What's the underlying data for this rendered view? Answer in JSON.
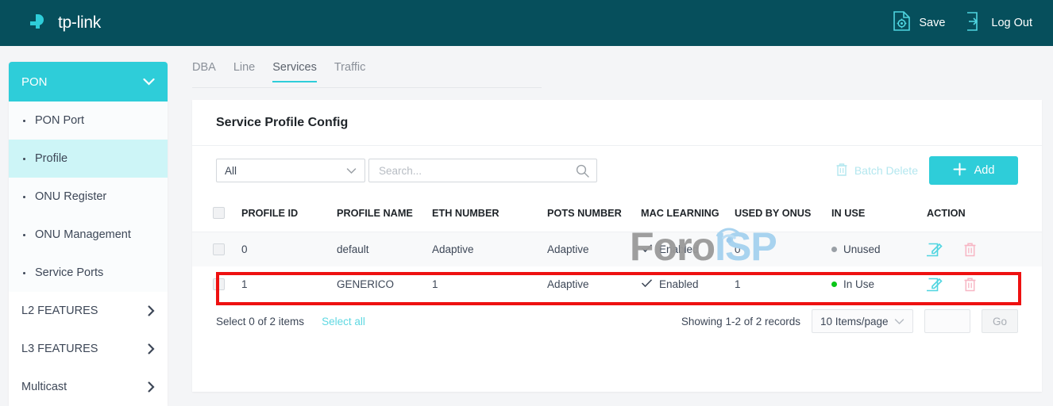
{
  "header": {
    "brand": "tp-link",
    "brand_icon": "tplink-logo-icon",
    "save_label": "Save",
    "save_icon": "save-document-gear-icon",
    "logout_label": "Log Out",
    "logout_icon": "logout-arrow-icon"
  },
  "sidebar": {
    "group_label": "PON",
    "group_icon": "chevron-down-icon",
    "items": [
      {
        "label": "PON Port",
        "active": false
      },
      {
        "label": "Profile",
        "active": true
      },
      {
        "label": "ONU Register",
        "active": false
      },
      {
        "label": "ONU Management",
        "active": false
      },
      {
        "label": "Service Ports",
        "active": false
      }
    ],
    "groups": [
      {
        "label": "L2 FEATURES",
        "icon": "chevron-right-icon"
      },
      {
        "label": "L3 FEATURES",
        "icon": "chevron-right-icon"
      },
      {
        "label": "Multicast",
        "icon": "chevron-right-icon"
      }
    ]
  },
  "tabs": [
    {
      "label": "DBA",
      "active": false
    },
    {
      "label": "Line",
      "active": false
    },
    {
      "label": "Services",
      "active": true
    },
    {
      "label": "Traffic",
      "active": false
    }
  ],
  "card": {
    "title": "Service Profile Config",
    "filter_value": "All",
    "filter_icon": "chevron-down-icon",
    "search_placeholder": "Search...",
    "search_value": "",
    "search_icon": "search-icon",
    "batch_delete_label": "Batch Delete",
    "batch_delete_icon": "trash-icon",
    "add_label": "Add",
    "add_icon": "plus-icon"
  },
  "table": {
    "columns": [
      "PROFILE ID",
      "PROFILE NAME",
      "ETH NUMBER",
      "POTS NUMBER",
      "MAC LEARNING",
      "USED BY ONUS",
      "IN USE",
      "ACTION"
    ],
    "header_checkbox_icon": "checkbox-unchecked-icon",
    "rows": [
      {
        "checkbox_icon": "checkbox-unchecked-icon",
        "profile_id": "0",
        "profile_name": "default",
        "eth_number": "Adaptive",
        "pots_number": "Adaptive",
        "mac_learning": "Enabled",
        "mac_learning_icon": "check-icon",
        "used_by_onus": "0",
        "in_use": "Unused",
        "in_use_color": "#9aa0a6",
        "edit_icon": "edit-pencil-icon",
        "delete_icon": "trash-icon",
        "highlighted": false
      },
      {
        "checkbox_icon": "checkbox-unchecked-icon",
        "profile_id": "1",
        "profile_name": "GENERICO",
        "eth_number": "1",
        "pots_number": "Adaptive",
        "mac_learning": "Enabled",
        "mac_learning_icon": "check-icon",
        "used_by_onus": "1",
        "in_use": "In Use",
        "in_use_color": "#0ac617",
        "edit_icon": "edit-pencil-icon",
        "delete_icon": "trash-icon",
        "highlighted": true
      }
    ]
  },
  "footer": {
    "select_count": "Select 0 of 2 items",
    "select_all_label": "Select all",
    "records_label": "Showing 1-2 of 2 records",
    "items_per_page": "10 Items/page",
    "items_per_page_icon": "chevron-down-icon",
    "page_input_value": "",
    "go_label": "Go"
  },
  "watermark": {
    "text_left": "Foro",
    "text_right": "ISP",
    "icon": "antenna-signal-icon"
  },
  "colors": {
    "header_bg": "#064f5c",
    "accent": "#2ecdd9",
    "accent_light": "#cdf5f7",
    "highlight": "#ee1111",
    "status_green": "#0ac617",
    "status_gray": "#9aa0a6"
  }
}
